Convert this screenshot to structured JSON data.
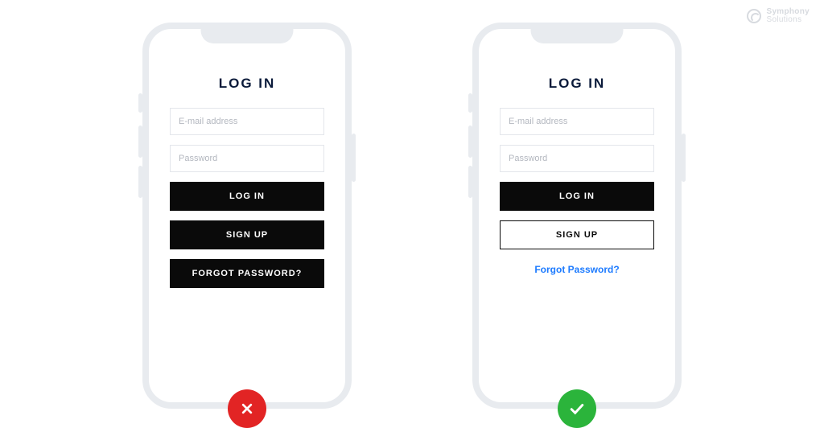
{
  "watermark": {
    "line1": "Symphony",
    "line2": "Solutions"
  },
  "bad": {
    "title": "LOG IN",
    "email_placeholder": "E-mail address",
    "password_placeholder": "Password",
    "login_label": "LOG IN",
    "signup_label": "SIGN UP",
    "forgot_label": "FORGOT PASSWORD?",
    "verdict": "incorrect"
  },
  "good": {
    "title": "LOG IN",
    "email_placeholder": "E-mail address",
    "password_placeholder": "Password",
    "login_label": "LOG IN",
    "signup_label": "SIGN UP",
    "forgot_label": "Forgot Password?",
    "verdict": "correct"
  },
  "colors": {
    "phone_outline": "#E8EBEF",
    "title_text": "#0A1A3A",
    "field_border": "#E3E6EB",
    "placeholder": "#B3B7BF",
    "button_dark": "#0A0A0A",
    "link_blue": "#1D7BFF",
    "bad_badge": "#E22424",
    "good_badge": "#2BB43B"
  }
}
